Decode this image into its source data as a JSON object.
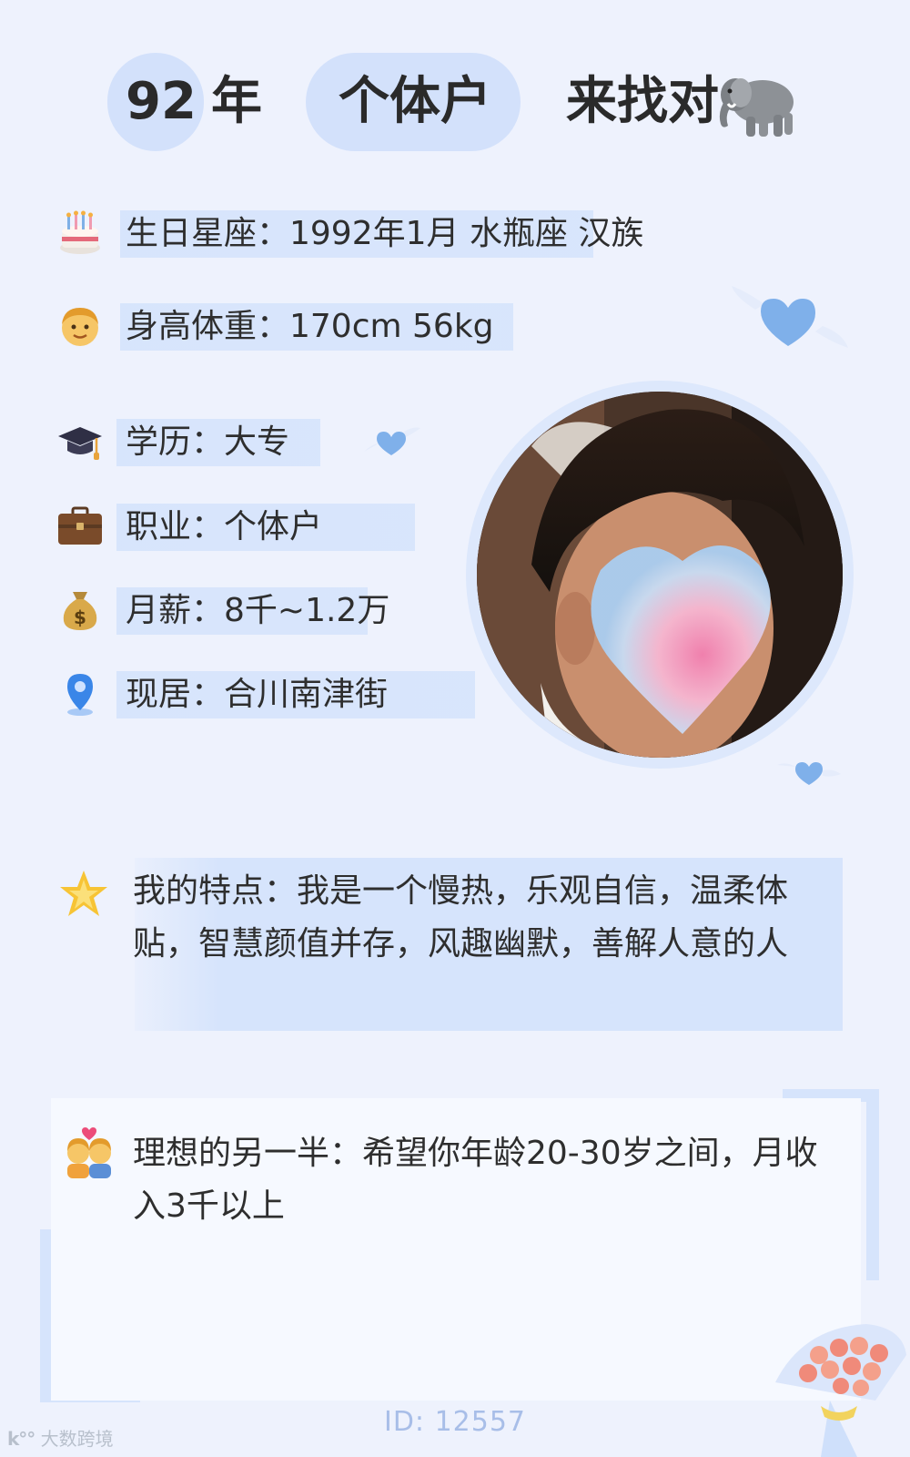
{
  "header": {
    "year_number": "92",
    "year_unit": "年",
    "occupation": "个体户",
    "seeking": "来找对"
  },
  "profile": {
    "birthday": "生日星座：1992年1月 水瓶座 汉族",
    "height_weight": "身高体重：170cm 56kg",
    "education": "学历：大专",
    "occupation": "职业：个体户",
    "salary": "月薪：8千~1.2万",
    "residence": "现居：合川南津街"
  },
  "features": {
    "text": "我的特点：我是一个慢热，乐观自信，温柔体贴，智慧颜值并存，风趣幽默，善解人意的人"
  },
  "ideal_partner": {
    "text": "理想的另一半：希望你年龄20-30岁之间，月收入3千以上"
  },
  "footer": {
    "id_label": "ID: 12557",
    "watermark": "大数跨境"
  },
  "colors": {
    "background": "#eef2fd",
    "highlight": "#d6e4fc",
    "heart": "#6aa0e8",
    "id_text": "#a8bee8"
  },
  "icons": {
    "header": "elephant-icon",
    "birthday": "cake-icon",
    "height_weight": "man-face-icon",
    "education": "graduation-cap-icon",
    "occupation": "briefcase-icon",
    "salary": "money-bag-icon",
    "residence": "location-pin-icon",
    "features": "star-icon",
    "ideal_partner": "couple-heart-icon"
  }
}
